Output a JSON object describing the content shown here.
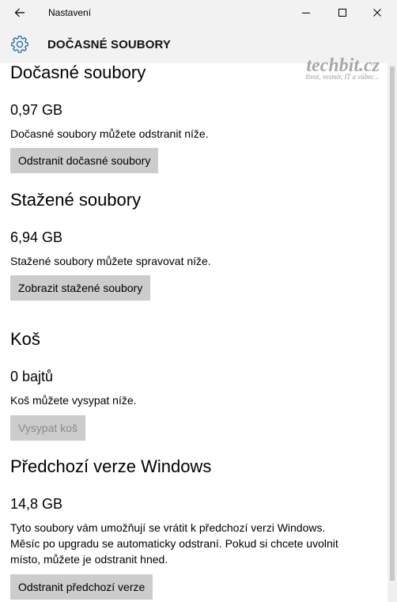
{
  "window": {
    "app_title": "Nastavení",
    "icons": {
      "back": "back-arrow-icon",
      "minimize": "minimize-icon",
      "maximize": "maximize-icon",
      "close": "close-icon"
    }
  },
  "header": {
    "title": "DOČASNÉ SOUBORY",
    "icon": "gear-icon"
  },
  "watermark": {
    "logo": "techbit.cz",
    "tagline": "život, vesmír, IT a vůbec..."
  },
  "sections": {
    "temp": {
      "title": "Dočasné soubory",
      "size": "0,97 GB",
      "description": "Dočasné soubory můžete odstranit níže.",
      "button": "Odstranit dočasné soubory"
    },
    "downloads": {
      "title": "Stažené soubory",
      "size": "6,94 GB",
      "description": "Stažené soubory můžete spravovat níže.",
      "button": "Zobrazit stažené soubory"
    },
    "recycle": {
      "title": "Koš",
      "size": "0 bajtů",
      "description": "Koš můžete vysypat níže.",
      "button": "Vysypat koš",
      "button_disabled": true
    },
    "previous": {
      "title": "Předchozí verze Windows",
      "size": "14,8 GB",
      "description_lines": [
        "Tyto soubory vám umožňují se vrátit k předchozí verzi Windows.",
        "Měsíc po upgradu se automaticky odstraní. Pokud si chcete uvolnit",
        "místo, můžete je odstranit hned."
      ],
      "button": "Odstranit předchozí verze"
    }
  }
}
